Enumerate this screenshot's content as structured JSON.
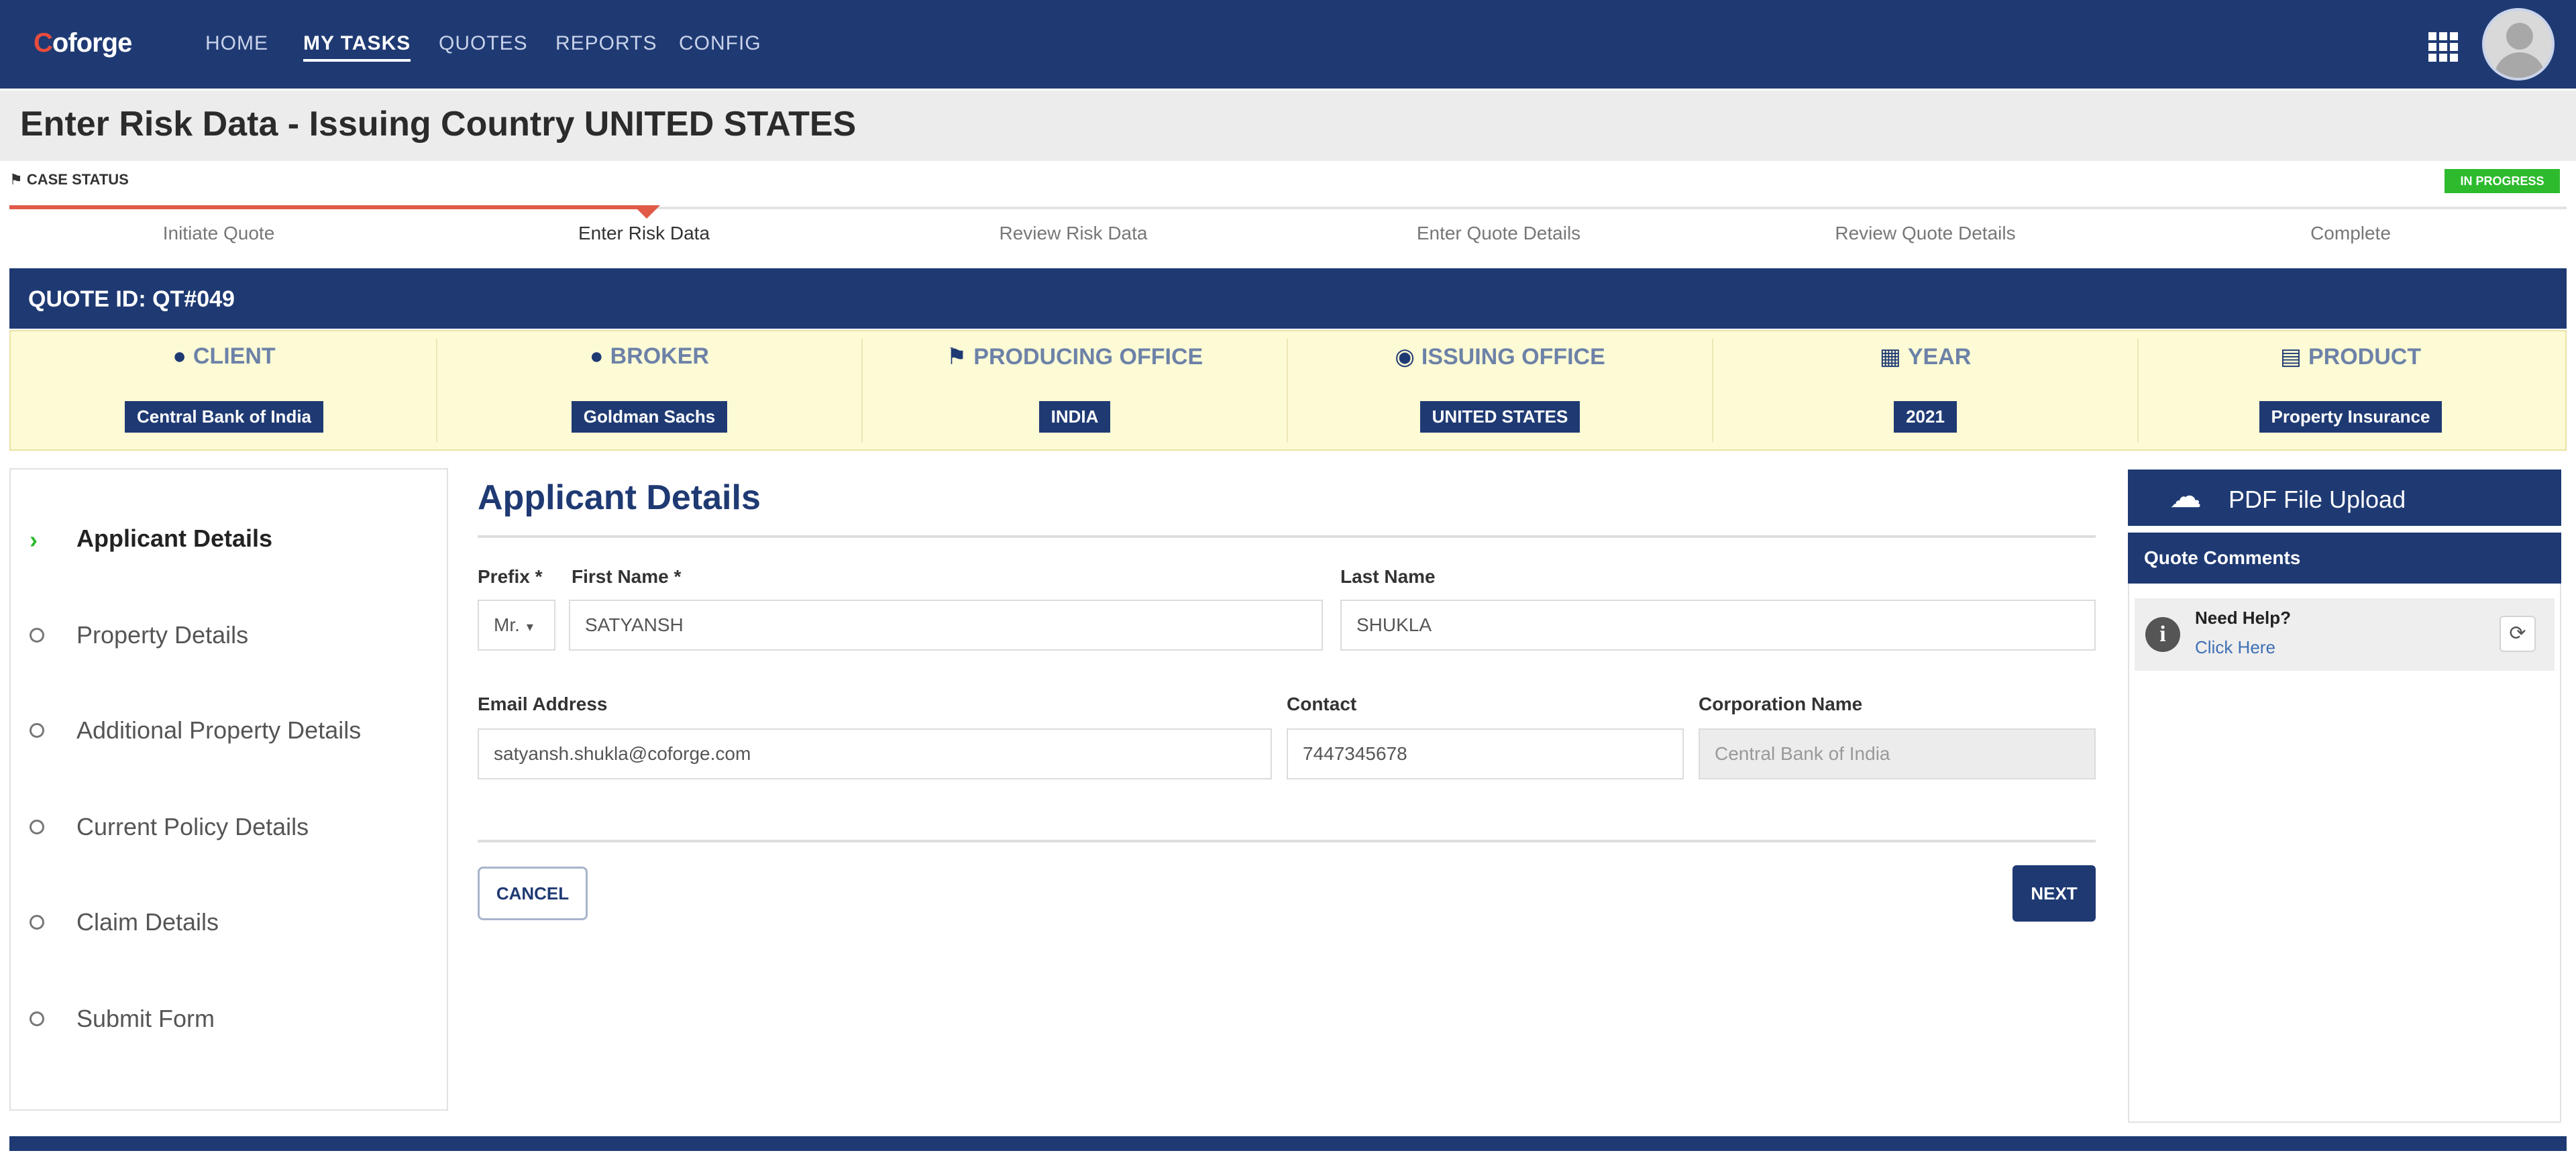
{
  "app": {
    "logo": "Coforge"
  },
  "nav": {
    "items": [
      {
        "label": "HOME",
        "active": false
      },
      {
        "label": "MY TASKS",
        "active": true
      },
      {
        "label": "QUOTES",
        "active": false
      },
      {
        "label": "REPORTS",
        "active": false
      },
      {
        "label": "CONFIG",
        "active": false
      }
    ],
    "apps_icon": "grid-icon",
    "avatar_icon": "user-avatar-icon"
  },
  "page": {
    "title": "Enter Risk Data - Issuing Country UNITED STATES"
  },
  "case_status": {
    "label": "CASE STATUS",
    "badge": "IN PROGRESS",
    "badge_color": "#2dbb2d",
    "steps": [
      "Initiate Quote",
      "Enter Risk Data",
      "Review Risk Data",
      "Enter Quote Details",
      "Review Quote Details",
      "Complete"
    ],
    "current_step": 1
  },
  "quote": {
    "id_label": "QUOTE ID: QT#049",
    "info": [
      {
        "label": "CLIENT",
        "icon": "user-icon",
        "value": "Central Bank of India"
      },
      {
        "label": "BROKER",
        "icon": "user-tie-icon",
        "value": "Goldman Sachs"
      },
      {
        "label": "PRODUCING OFFICE",
        "icon": "flag-icon",
        "value": "INDIA"
      },
      {
        "label": "ISSUING OFFICE",
        "icon": "globe-icon",
        "value": "UNITED STATES"
      },
      {
        "label": "YEAR",
        "icon": "calendar-icon",
        "value": "2021"
      },
      {
        "label": "PRODUCT",
        "icon": "document-icon",
        "value": "Property Insurance"
      }
    ]
  },
  "sidebar": {
    "items": [
      {
        "label": "Applicant Details",
        "active": true
      },
      {
        "label": "Property Details",
        "active": false
      },
      {
        "label": "Additional Property Details",
        "active": false
      },
      {
        "label": "Current Policy Details",
        "active": false
      },
      {
        "label": "Claim Details",
        "active": false
      },
      {
        "label": "Submit Form",
        "active": false
      }
    ]
  },
  "form": {
    "title": "Applicant Details",
    "prefix": {
      "label": "Prefix *",
      "value": "Mr."
    },
    "first_name": {
      "label": "First Name *",
      "value": "SATYANSH"
    },
    "last_name": {
      "label": "Last Name",
      "value": "SHUKLA"
    },
    "email": {
      "label": "Email Address",
      "value": "satyansh.shukla@coforge.com"
    },
    "contact": {
      "label": "Contact",
      "value": "7447345678"
    },
    "corporation": {
      "label": "Corporation Name",
      "value": "Central Bank of India"
    },
    "cancel_label": "CANCEL",
    "next_label": "NEXT"
  },
  "right_panel": {
    "upload_label": "PDF File Upload",
    "upload_icon": "cloud-upload-icon",
    "comments_title": "Quote Comments",
    "help_title": "Need Help?",
    "help_link": "Click Here",
    "help_icon": "info-icon",
    "refresh_icon": "refresh-icon"
  },
  "colors": {
    "primary": "#1f3a73",
    "accent": "#e05a47",
    "banner": "#fdfbd5",
    "success": "#2dbb2d"
  }
}
